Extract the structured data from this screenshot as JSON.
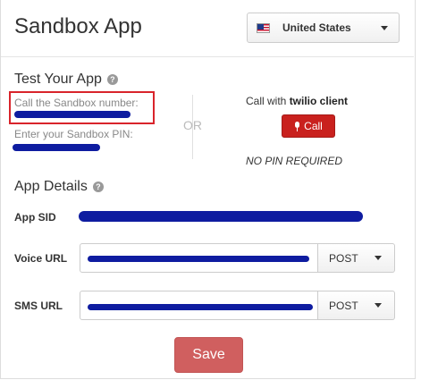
{
  "app": {
    "title": "Sandbox App"
  },
  "country_select": {
    "label": "United States",
    "flag": "us-flag-icon"
  },
  "test_section": {
    "heading": "Test Your App",
    "sandbox_number_label": "Call the Sandbox number:",
    "sandbox_pin_label": "Enter your Sandbox PIN:",
    "or_text": "OR",
    "client_prefix": "Call with ",
    "client_name": "twilio client",
    "call_button": "Call",
    "no_pin_text": "NO PIN REQUIRED"
  },
  "details_section": {
    "heading": "App Details",
    "app_sid_label": "App SID",
    "voice_url_label": "Voice URL",
    "voice_method": "POST",
    "sms_url_label": "SMS URL",
    "sms_method": "POST"
  },
  "save_button": "Save",
  "colors": {
    "call_red": "#c9211e",
    "save_red": "#d05f5f",
    "redaction_blue": "#0e1ca0",
    "highlight_red": "#d9242b"
  }
}
